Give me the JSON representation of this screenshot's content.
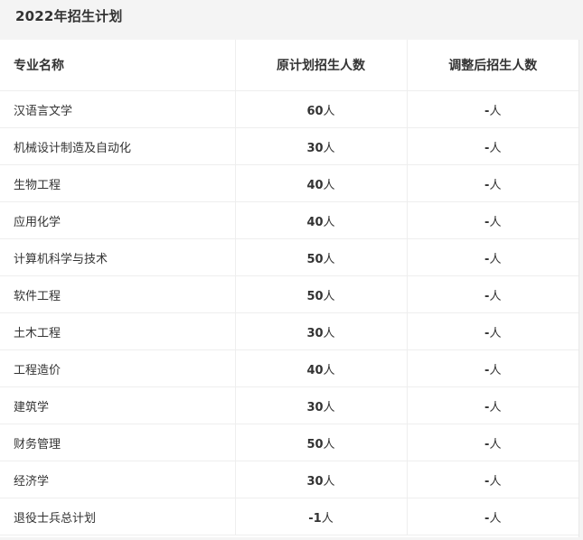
{
  "title": "2022年招生计划",
  "table": {
    "headers": [
      "专业名称",
      "原计划招生人数",
      "调整后招生人数"
    ],
    "rows": [
      {
        "major": "汉语言文学",
        "planned_number": "60",
        "planned_unit": "人",
        "adjusted_number": "-",
        "adjusted_unit": "人"
      },
      {
        "major": "机械设计制造及自动化",
        "planned_number": "30",
        "planned_unit": "人",
        "adjusted_number": "-",
        "adjusted_unit": "人"
      },
      {
        "major": "生物工程",
        "planned_number": "40",
        "planned_unit": "人",
        "adjusted_number": "-",
        "adjusted_unit": "人"
      },
      {
        "major": "应用化学",
        "planned_number": "40",
        "planned_unit": "人",
        "adjusted_number": "-",
        "adjusted_unit": "人"
      },
      {
        "major": "计算机科学与技术",
        "planned_number": "50",
        "planned_unit": "人",
        "adjusted_number": "-",
        "adjusted_unit": "人"
      },
      {
        "major": "软件工程",
        "planned_number": "50",
        "planned_unit": "人",
        "adjusted_number": "-",
        "adjusted_unit": "人"
      },
      {
        "major": "土木工程",
        "planned_number": "30",
        "planned_unit": "人",
        "adjusted_number": "-",
        "adjusted_unit": "人"
      },
      {
        "major": "工程造价",
        "planned_number": "40",
        "planned_unit": "人",
        "adjusted_number": "-",
        "adjusted_unit": "人"
      },
      {
        "major": "建筑学",
        "planned_number": "30",
        "planned_unit": "人",
        "adjusted_number": "-",
        "adjusted_unit": "人"
      },
      {
        "major": "财务管理",
        "planned_number": "50",
        "planned_unit": "人",
        "adjusted_number": "-",
        "adjusted_unit": "人"
      },
      {
        "major": "经济学",
        "planned_number": "30",
        "planned_unit": "人",
        "adjusted_number": "-",
        "adjusted_unit": "人"
      },
      {
        "major": "退役士兵总计划",
        "planned_number": "-1",
        "planned_unit": "人",
        "adjusted_number": "-",
        "adjusted_unit": "人"
      }
    ]
  },
  "colors": {
    "panel_background": "#f4f4f4",
    "table_background": "#ffffff",
    "text": "#333333",
    "border": "#eeeeee"
  }
}
